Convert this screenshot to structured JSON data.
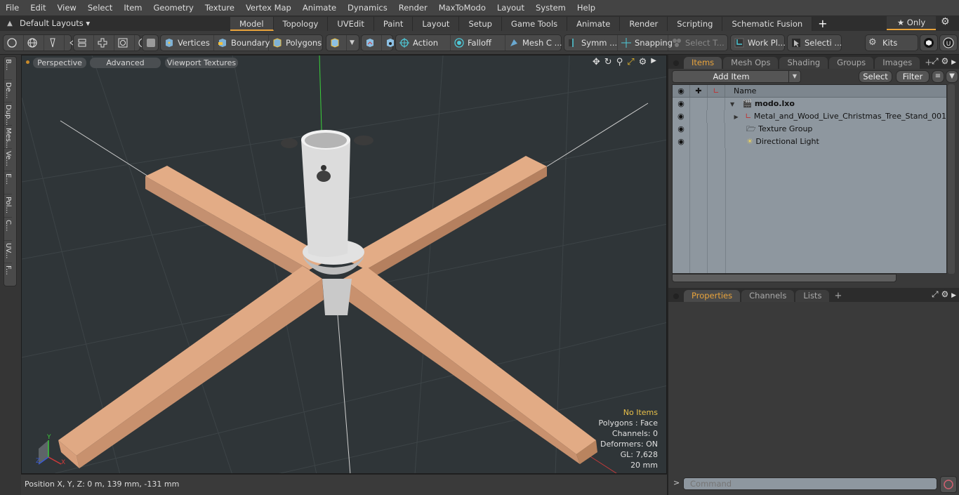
{
  "menubar": [
    "File",
    "Edit",
    "View",
    "Select",
    "Item",
    "Geometry",
    "Texture",
    "Vertex Map",
    "Animate",
    "Dynamics",
    "Render",
    "MaxToModo",
    "Layout",
    "System",
    "Help"
  ],
  "layoutbar": {
    "layouts_label": "Default Layouts ▾",
    "tabs": [
      "Model",
      "Topology",
      "UVEdit",
      "Paint",
      "Layout",
      "Setup",
      "Game Tools",
      "Animate",
      "Render",
      "Scripting",
      "Schematic Fusion"
    ],
    "active_tab": "Model",
    "add_tab": "+",
    "only_label": "★ Only"
  },
  "toolbar": {
    "selection_modes": [
      "Vertices",
      "Boundary",
      "Polygons"
    ],
    "action": "Action",
    "falloff": "Falloff",
    "mesh_constraints": "Mesh C ...",
    "symmetry": "Symm ...",
    "snapping": "Snapping",
    "select_through": "Select T...",
    "work_plane": "Work Pl...",
    "selection_sets": "Selecti ...",
    "kits": "Kits"
  },
  "left_tabs": [
    "B...",
    "De...",
    "Dup...",
    "Mes...",
    "Ve...",
    "E...",
    "Pol...",
    "C...",
    "UV...",
    "F..."
  ],
  "viewport": {
    "view_mode": "Perspective",
    "shading": "Advanced",
    "textures": "Viewport Textures",
    "hud": {
      "selection": "No Items",
      "polygons": "Polygons : Face",
      "channels": "Channels: 0",
      "deformers": "Deformers: ON",
      "gl": "GL: 7,628",
      "grid": "20 mm"
    },
    "axes": {
      "x": "X",
      "y": "Y",
      "z": "Z"
    }
  },
  "status": {
    "position": "Position X, Y, Z:   0 m, 139 mm, -131 mm"
  },
  "items_panel": {
    "tabs": [
      "Items",
      "Mesh Ops",
      "Shading",
      "Groups",
      "Images"
    ],
    "active_tab": "Items",
    "add_item": "Add Item",
    "select": "Select",
    "filter": "Filter",
    "column_name": "Name",
    "tree": [
      {
        "name": "modo.lxo",
        "level": 0,
        "bold": true,
        "icon": "scene-icon",
        "expanded": true
      },
      {
        "name": "Metal_and_Wood_Live_Christmas_Tree_Stand_001",
        "level": 1,
        "icon": "mesh-locator-icon",
        "expanded": false
      },
      {
        "name": "Texture Group",
        "level": 1,
        "icon": "texture-group-icon"
      },
      {
        "name": "Directional Light",
        "level": 1,
        "icon": "light-icon"
      }
    ]
  },
  "properties_panel": {
    "tabs": [
      "Properties",
      "Channels",
      "Lists"
    ],
    "active_tab": "Properties"
  },
  "command": {
    "prompt": ">",
    "placeholder": "Command"
  }
}
